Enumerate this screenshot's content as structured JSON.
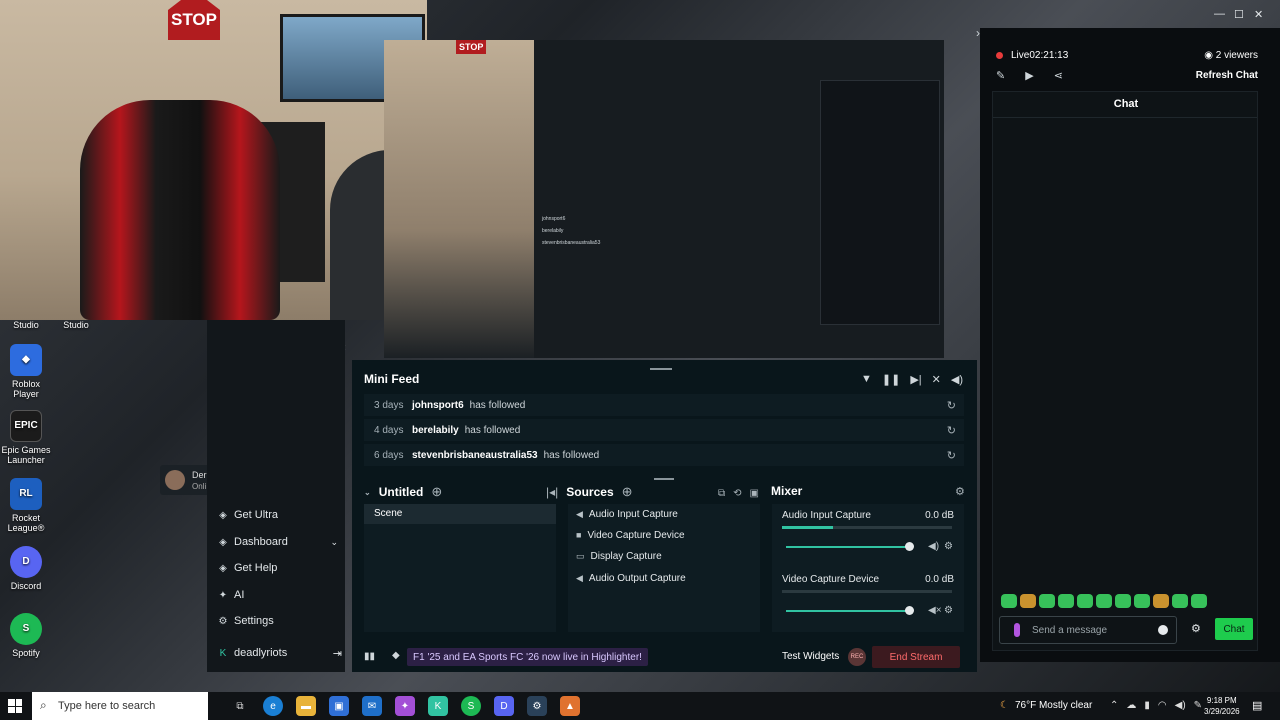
{
  "desktop": {
    "icons": [
      {
        "label": "Studio",
        "color": "#2d2d2d",
        "glyph": ""
      },
      {
        "label": "Studio",
        "color": "#2d2d2d",
        "glyph": ""
      },
      {
        "label": "Roblox Player",
        "color": "#2d6cdf",
        "glyph": "◆"
      },
      {
        "label": "Epic Games Launcher",
        "color": "#1b1b1b",
        "glyph": "EPIC"
      },
      {
        "label": "Rocket League®",
        "color": "#1d5fbf",
        "glyph": "RL"
      },
      {
        "label": "Discord",
        "color": "#5865f2",
        "glyph": "D"
      },
      {
        "label": "Spotify",
        "color": "#1db954",
        "glyph": "S"
      }
    ]
  },
  "webcam": {
    "stop_text": "STOP"
  },
  "user_card": {
    "name": "Der",
    "status": "Onli"
  },
  "nav": {
    "items": [
      {
        "label": "Get Ultra",
        "icon": "ultra-icon"
      },
      {
        "label": "Dashboard",
        "icon": "dashboard-icon"
      },
      {
        "label": "Get Help",
        "icon": "help-icon"
      },
      {
        "label": "AI",
        "icon": "ai-icon"
      },
      {
        "label": "Settings",
        "icon": "settings-icon"
      },
      {
        "label": "deadlyriots",
        "icon": "streamlabs-icon"
      }
    ]
  },
  "mini_feed": {
    "title": "Mini Feed",
    "rows": [
      {
        "days": "3 days",
        "user": "johnsport6",
        "action": "has followed"
      },
      {
        "days": "4 days",
        "user": "berelabily",
        "action": "has followed"
      },
      {
        "days": "6 days",
        "user": "stevenbrisbaneaustralia53",
        "action": "has followed"
      }
    ]
  },
  "scenes": {
    "title": "Untitled",
    "items": [
      "Scene"
    ]
  },
  "sources": {
    "title": "Sources",
    "items": [
      {
        "label": "Audio Input Capture",
        "icon": "speaker-icon"
      },
      {
        "label": "Video Capture Device",
        "icon": "camera-icon"
      },
      {
        "label": "Display Capture",
        "icon": "monitor-icon"
      },
      {
        "label": "Audio Output Capture",
        "icon": "speaker-icon"
      }
    ]
  },
  "mixer": {
    "title": "Mixer",
    "channels": [
      {
        "name": "Audio Input Capture",
        "db": "0.0 dB",
        "level": 0.3,
        "volume": 1.0
      },
      {
        "name": "Video Capture Device",
        "db": "0.0 dB",
        "level": 0.0,
        "volume": 1.0
      }
    ]
  },
  "bottom_bar": {
    "highlighter": "F1 '25 and EA Sports FC '26 now live in Highlighter!",
    "test_widgets": "Test Widgets",
    "rec": "REC",
    "end_stream": "End Stream"
  },
  "chat": {
    "live_label": "Live",
    "live_time": "02:21:13",
    "viewers": "2 viewers",
    "refresh": "Refresh Chat",
    "title": "Chat",
    "placeholder": "Send a message",
    "send": "Chat"
  },
  "taskbar": {
    "search_placeholder": "Type here to search",
    "weather": "76°F  Mostly clear",
    "time": "9:18 PM",
    "date": "3/29/2026"
  },
  "colors": {
    "accent": "#31c3a2",
    "live": "#e83b3b",
    "chat_button": "#1ecc4d"
  }
}
